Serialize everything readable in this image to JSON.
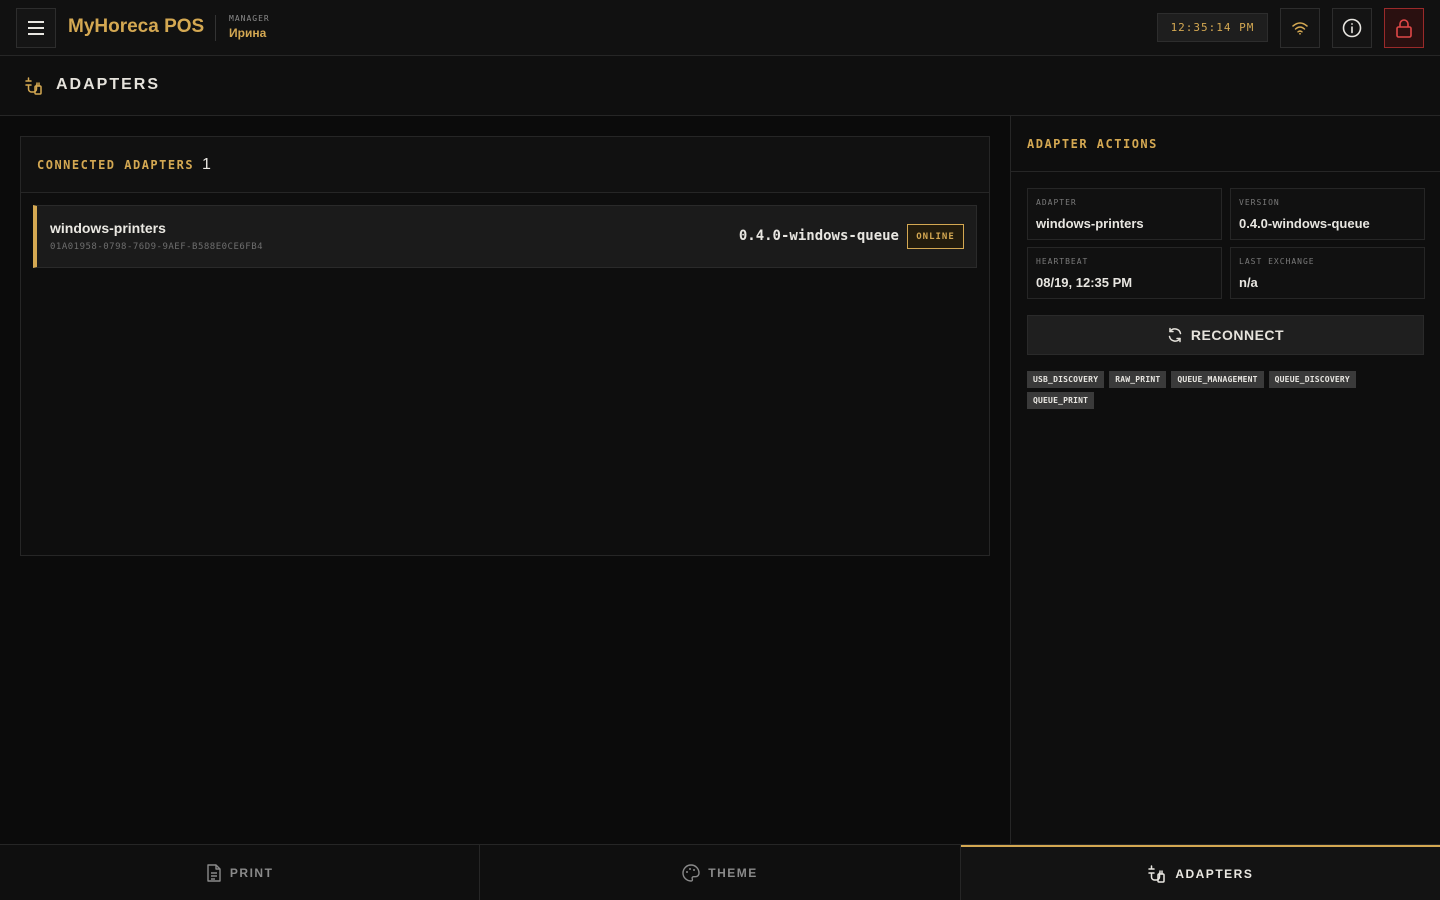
{
  "header": {
    "brand": "MyHoreca POS",
    "role_label": "MANAGER",
    "user_name": "Ирина",
    "clock": "12:35:14 PM"
  },
  "page": {
    "title": "ADAPTERS"
  },
  "connected": {
    "label": "CONNECTED ADAPTERS",
    "count": "1",
    "adapters": [
      {
        "name": "windows-printers",
        "id": "01A01958-0798-76D9-9AEF-B588E0CE6FB4",
        "version": "0.4.0-windows-queue",
        "status": "ONLINE"
      }
    ]
  },
  "actions": {
    "title": "ADAPTER ACTIONS",
    "fields": [
      {
        "label": "ADAPTER",
        "value": "windows-printers"
      },
      {
        "label": "VERSION",
        "value": "0.4.0-windows-queue"
      },
      {
        "label": "HEARTBEAT",
        "value": "08/19, 12:35 PM"
      },
      {
        "label": "LAST EXCHANGE",
        "value": "n/a"
      }
    ],
    "reconnect_label": "RECONNECT",
    "capabilities": [
      "USB_DISCOVERY",
      "RAW_PRINT",
      "QUEUE_MANAGEMENT",
      "QUEUE_DISCOVERY",
      "QUEUE_PRINT"
    ]
  },
  "bottom_nav": {
    "tabs": [
      {
        "label": "PRINT",
        "icon": "document-icon",
        "active": false
      },
      {
        "label": "THEME",
        "icon": "palette-icon",
        "active": false
      },
      {
        "label": "ADAPTERS",
        "icon": "adapter-icon",
        "active": true
      }
    ]
  },
  "colors": {
    "accent": "#d4a852",
    "background": "#0b0b0b",
    "danger": "#9a2a2a"
  }
}
